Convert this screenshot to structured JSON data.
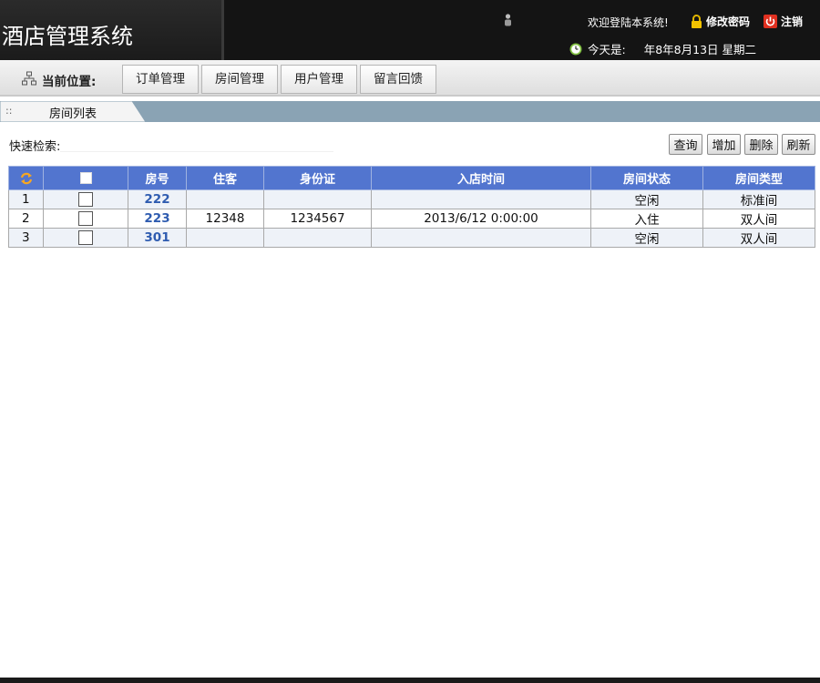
{
  "header": {
    "app_title": "酒店管理系统",
    "welcome": "欢迎登陆本系统!",
    "change_password": "修改密码",
    "logout": "注销",
    "date_prefix": "今天是:",
    "date_value": "年8年8月13日 星期二",
    "icons": [
      "user-icon",
      "lock-icon",
      "power-icon",
      "clock-icon"
    ]
  },
  "nav": {
    "location_label": "当前位置:",
    "tabs": [
      {
        "label": "订单管理"
      },
      {
        "label": "房间管理"
      },
      {
        "label": "用户管理"
      },
      {
        "label": "留言回馈"
      }
    ]
  },
  "panel": {
    "title": "房间列表",
    "grip": "::"
  },
  "search": {
    "label": "快速检索:",
    "value": "",
    "placeholder": ""
  },
  "toolbar": {
    "query": "查询",
    "add": "增加",
    "delete": "删除",
    "refresh": "刷新"
  },
  "table": {
    "columns": [
      "",
      "",
      "房号",
      "住客",
      "身份证",
      "入店时间",
      "房间状态",
      "房间类型"
    ],
    "rows": [
      {
        "index": "1",
        "room": "222",
        "guest": "",
        "id_card": "",
        "checkin": "",
        "status": "空闲",
        "type": "标准间"
      },
      {
        "index": "2",
        "room": "223",
        "guest": "12348",
        "id_card": "1234567",
        "checkin": "2013/6/12 0:00:00",
        "status": "入住",
        "type": "双人间"
      },
      {
        "index": "3",
        "room": "301",
        "guest": "",
        "id_card": "",
        "checkin": "",
        "status": "空闲",
        "type": "双人间"
      }
    ]
  },
  "colors": {
    "header_bg": "#141414",
    "table_header": "#5275cf",
    "room_link": "#2f5cb0",
    "panel_bar": "#8aa3b4"
  }
}
